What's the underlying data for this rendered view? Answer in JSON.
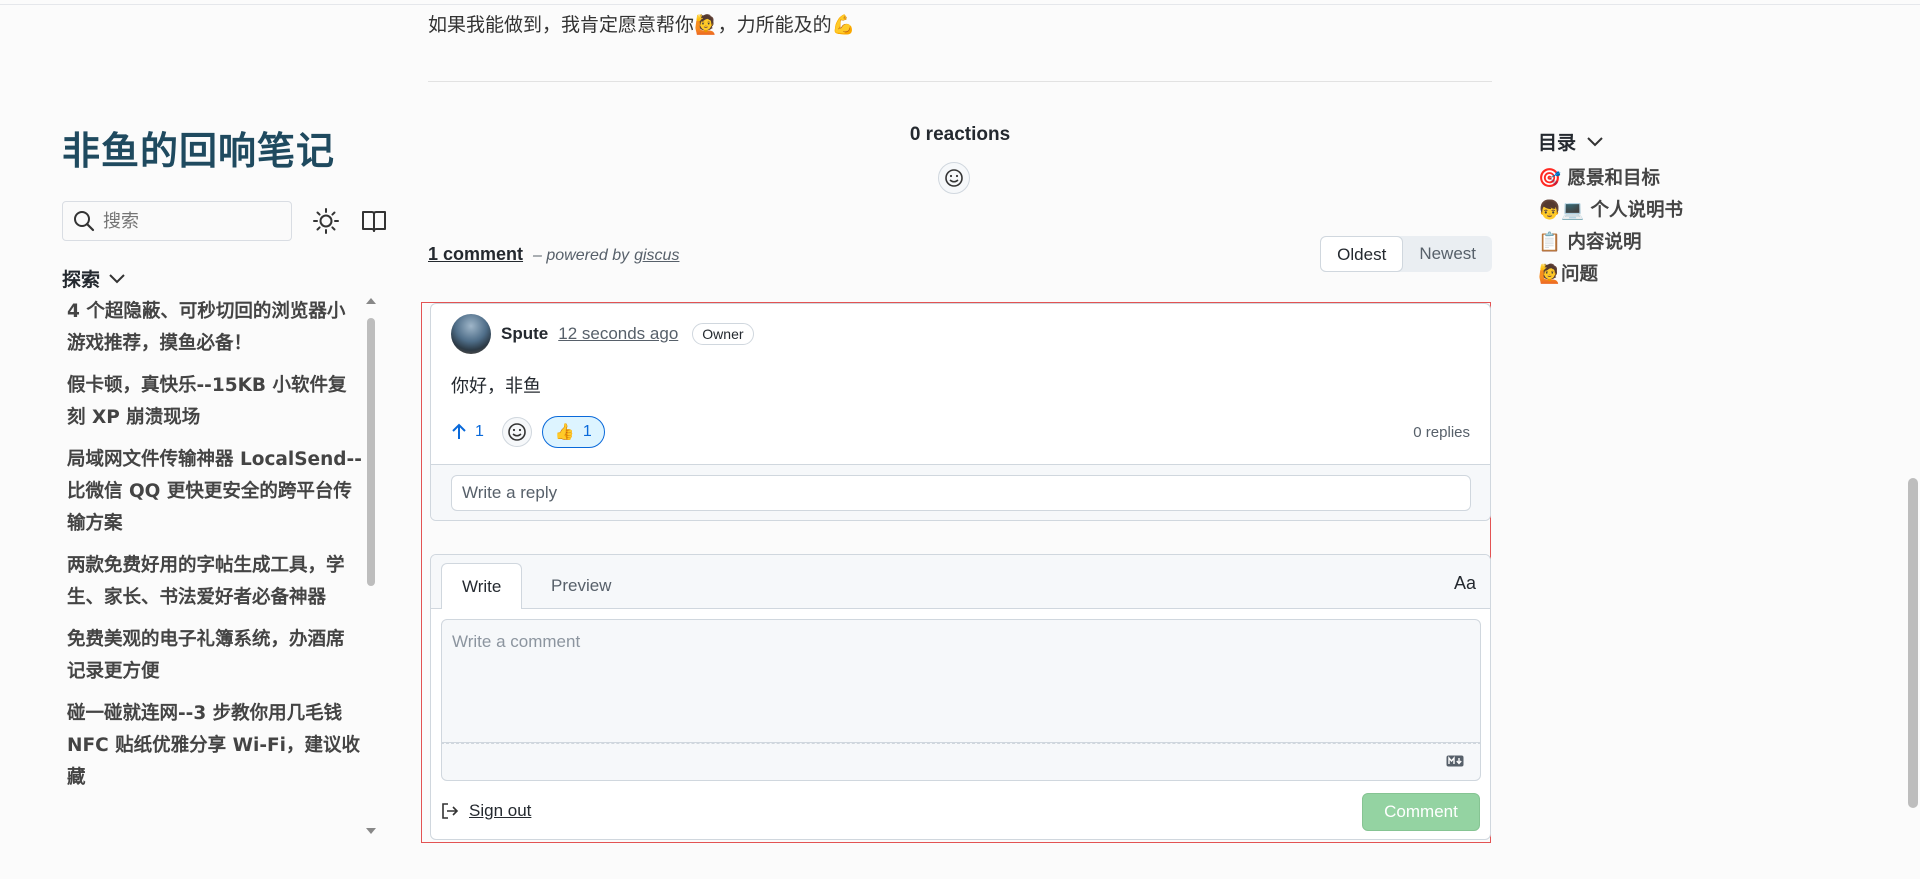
{
  "sidebar": {
    "site_title": "非鱼的回响笔记",
    "search_placeholder": "搜索",
    "explore_label": "探索",
    "posts": [
      "4 个超隐蔽、可秒切回的浏览器小游戏推荐，摸鱼必备！",
      "假卡顿，真快乐--15KB 小软件复刻 XP 崩溃现场",
      "局域网文件传输神器 LocalSend--比微信 QQ 更快更安全的跨平台传输方案",
      "两款免费好用的字帖生成工具，学生、家长、书法爱好者必备神器",
      "免费美观的电子礼簿系统，办酒席记录更方便",
      "碰一碰就连网--3 步教你用几毛钱 NFC 贴纸优雅分享 Wi-Fi，建议收藏"
    ]
  },
  "main": {
    "intro_text": "如果我能做到，我肯定愿意帮你🙋，力所能及的💪",
    "reactions_label": "0 reactions",
    "comment_count": "1 comment",
    "powered_by": "– powered by",
    "giscus": "giscus",
    "sort": {
      "oldest": "Oldest",
      "newest": "Newest"
    }
  },
  "comment": {
    "author": "Spute",
    "time": "12 seconds ago",
    "badge": "Owner",
    "body": "你好，非鱼",
    "upvotes": "1",
    "thumbs_count": "1",
    "replies": "0 replies",
    "reply_placeholder": "Write a reply"
  },
  "editor": {
    "tab_write": "Write",
    "tab_preview": "Preview",
    "font_toggle": "Aa",
    "placeholder": "Write a comment",
    "sign_out": "Sign out",
    "submit": "Comment"
  },
  "toc": {
    "title": "目录",
    "items": [
      "🎯 愿景和目标",
      "👦💻 个人说明书",
      "📋 内容说明",
      "🙋问题"
    ]
  },
  "colors": {
    "site_title": "#1f4a5f",
    "highlight_frame": "#e35353",
    "upvote": "#0969da",
    "comment_button": "#94d3a2"
  }
}
